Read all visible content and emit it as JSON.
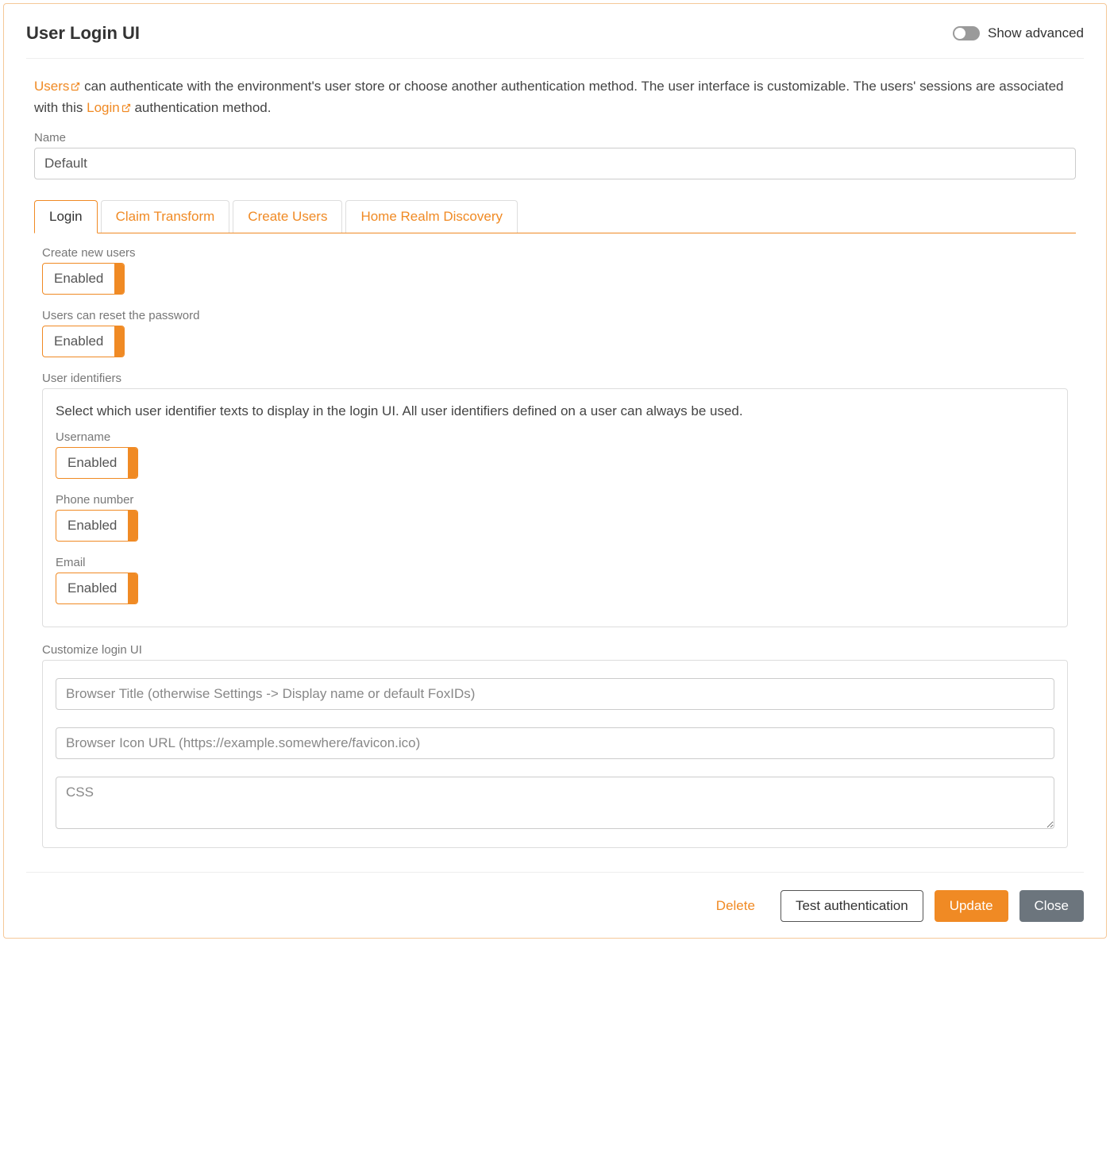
{
  "header": {
    "title": "User Login UI",
    "show_advanced_label": "Show advanced"
  },
  "intro": {
    "users_link": "Users",
    "part1": " can authenticate with the environment's user store or choose another authentication method. The user interface is customizable. The users' sessions are associated with this ",
    "login_link": "Login",
    "part2": " authentication method."
  },
  "name_field": {
    "label": "Name",
    "value": "Default"
  },
  "tabs": {
    "login": "Login",
    "claim_transform": "Claim Transform",
    "create_users": "Create Users",
    "home_realm_discovery": "Home Realm Discovery"
  },
  "create_new_users": {
    "label": "Create new users",
    "value": "Enabled"
  },
  "reset_password": {
    "label": "Users can reset the password",
    "value": "Enabled"
  },
  "user_identifiers": {
    "label": "User identifiers",
    "intro": "Select which user identifier texts to display in the login UI. All user identifiers defined on a user can always be used.",
    "username": {
      "label": "Username",
      "value": "Enabled"
    },
    "phone": {
      "label": "Phone number",
      "value": "Enabled"
    },
    "email": {
      "label": "Email",
      "value": "Enabled"
    }
  },
  "customize": {
    "label": "Customize login UI",
    "browser_title_placeholder": "Browser Title (otherwise Settings -> Display name or default FoxIDs)",
    "browser_icon_placeholder": "Browser Icon URL (https://example.somewhere/favicon.ico)",
    "css_placeholder": "CSS"
  },
  "footer": {
    "delete": "Delete",
    "test_auth": "Test authentication",
    "update": "Update",
    "close": "Close"
  }
}
